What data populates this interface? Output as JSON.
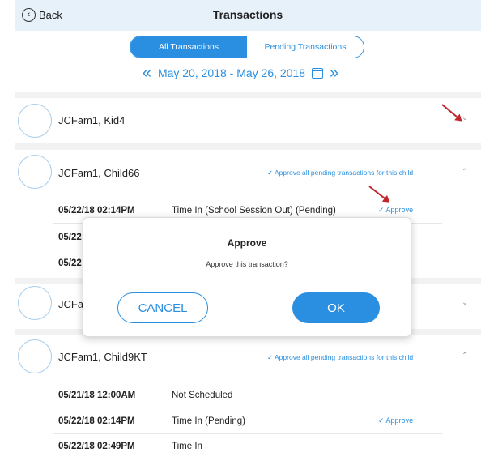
{
  "header": {
    "back_label": "Back",
    "title": "Transactions"
  },
  "tabs": [
    {
      "label": "All Transactions"
    },
    {
      "label": "Pending Transactions"
    }
  ],
  "date_range": {
    "label": "May 20, 2018 - May 26, 2018"
  },
  "children": [
    {
      "name": "JCFam1, Kid4"
    },
    {
      "name": "JCFam1, Child66",
      "approve_all_label": "Approve all pending transactions for this child"
    },
    {
      "name": "JCFa"
    },
    {
      "name": "JCFam1, Child9KT",
      "approve_all_label": "Approve all pending transactions for this child"
    }
  ],
  "child66_transactions": [
    {
      "date": "05/22/18 02:14PM",
      "description": "Time In (School Session Out) (Pending)",
      "approve_label": "Approve"
    },
    {
      "date": "05/22",
      "description": ""
    },
    {
      "date": "05/22",
      "description": ""
    }
  ],
  "child9kt_transactions": [
    {
      "date": "05/21/18 12:00AM",
      "description": "Not Scheduled"
    },
    {
      "date": "05/22/18 02:14PM",
      "description": "Time In (Pending)",
      "approve_label": "Approve"
    },
    {
      "date": "05/22/18 02:49PM",
      "description": "Time In"
    }
  ],
  "modal": {
    "title": "Approve",
    "message": "Approve this transaction?",
    "cancel_label": "CANCEL",
    "ok_label": "OK"
  },
  "colors": {
    "accent": "#2a8fe0",
    "header_bg": "#e6f1fa",
    "annotation_arrow": "#c0262b"
  }
}
